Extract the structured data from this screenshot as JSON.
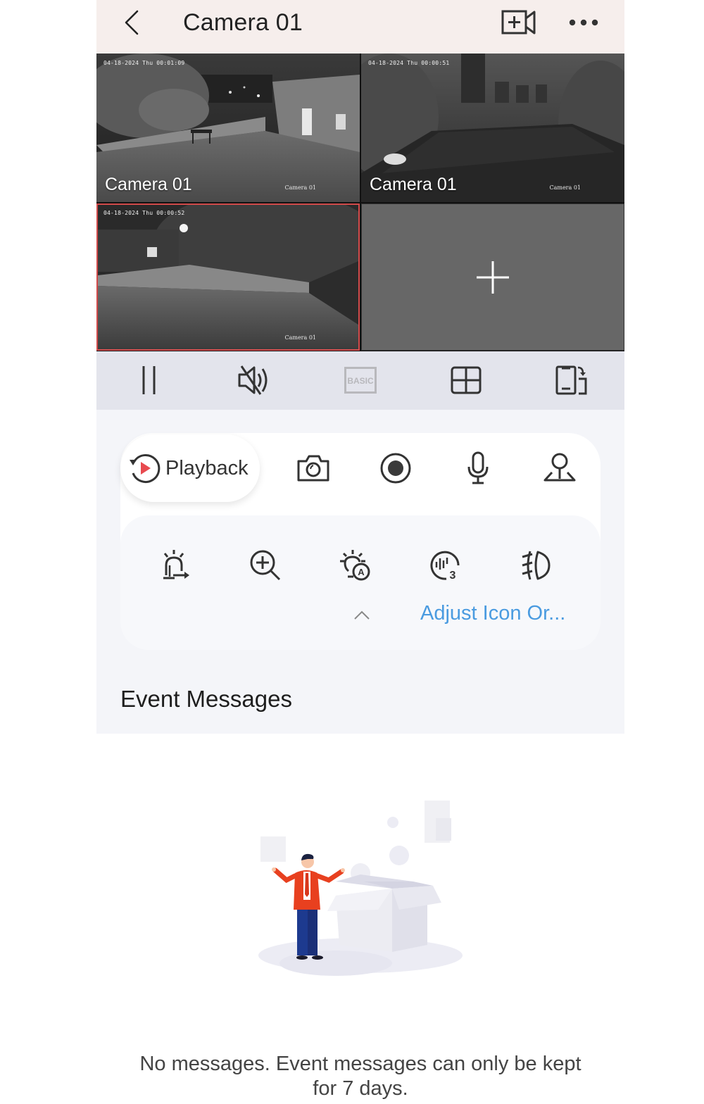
{
  "header": {
    "title": "Camera 01",
    "back_icon": "chevron-left-icon",
    "add_camera_icon": "video-add-icon",
    "more_icon": "more-dots-icon"
  },
  "grid": {
    "tiles": [
      {
        "label": "Camera 01",
        "osd_time": "04-18-2024 Thu 00:01:09",
        "osd_name": "Camera 01",
        "selected": false
      },
      {
        "label": "Camera 01",
        "osd_time": "04-18-2024 Thu 00:00:51",
        "osd_name": "Camera 01",
        "selected": false
      },
      {
        "label": "",
        "osd_time": "04-18-2024 Thu 00:00:52",
        "osd_name": "Camera 01",
        "selected": true
      },
      {
        "label": "",
        "empty": true,
        "icon": "add-plus-icon"
      }
    ],
    "selected_border_color": "#d24a4a"
  },
  "toolbar": {
    "buttons": [
      {
        "name": "pause",
        "icon": "pause-icon"
      },
      {
        "name": "mute",
        "icon": "speaker-muted-icon"
      },
      {
        "name": "quality",
        "icon": "basic-quality-icon",
        "label": "BASIC",
        "disabled": true
      },
      {
        "name": "layout",
        "icon": "grid-4-icon"
      },
      {
        "name": "rotate",
        "icon": "screen-rotate-icon"
      }
    ]
  },
  "actions": {
    "playback_label": "Playback",
    "row1": [
      "playback-icon",
      "camera-snapshot-icon",
      "record-icon",
      "microphone-icon",
      "ptz-joystick-icon"
    ],
    "row2": [
      "alarm-siren-icon",
      "zoom-in-icon",
      "auto-light-icon",
      "audio-alarm-3-icon",
      "fog-light-icon"
    ],
    "adjust_label": "Adjust Icon Or...",
    "collapse_icon": "chevron-up-icon",
    "accent_color": "#4a9be0"
  },
  "events": {
    "title": "Event Messages",
    "empty_message": "No messages. Event messages can only be kept for 7 days."
  }
}
